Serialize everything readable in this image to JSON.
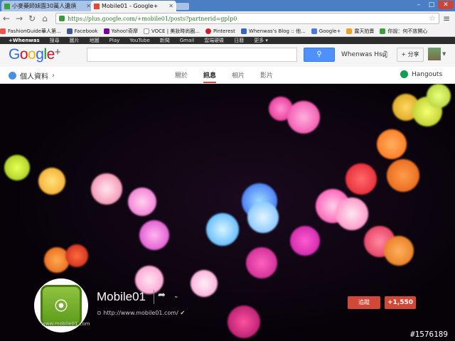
{
  "browser": {
    "tabs": [
      {
        "label": "小麥藥師妹園30萬人遺煩",
        "active": false
      },
      {
        "label": "Mobile01 - Google+",
        "active": true
      }
    ],
    "url": "https://plus.google.com/+mobile01/posts?partnerid=gplp0",
    "bookmarks": [
      "FashionGuide華人第...",
      "Facebook",
      "Yahoo!奇摩",
      "VOCE | 美妝時尚圈...",
      "Pinterest",
      "Whenwas's Blog :: 他...",
      "Google+",
      "露天拍賣",
      "你說：何不放開心"
    ]
  },
  "gbar": {
    "items": [
      "+Whenwas",
      "搜尋",
      "圖片",
      "地圖",
      "Play",
      "YouTube",
      "新聞",
      "Gmail",
      "雲端硬碟",
      "日曆",
      "更多 ▾"
    ]
  },
  "header": {
    "logo": "Google",
    "logo_plus": "+",
    "user_name": "Whenwas Hsu",
    "share_label": "+ 分享"
  },
  "subnav": {
    "profile_label": "個人資料",
    "tabs": [
      "關於",
      "訊息",
      "相片",
      "影片"
    ],
    "active_tab": "訊息",
    "hangouts_label": "Hangouts"
  },
  "page": {
    "name": "Mobile01",
    "url": "http://www.mobile01.com/",
    "avatar_caption": "www.mobile01.com",
    "follow_label": "追蹤",
    "plus_count": "+1,550"
  },
  "watermark": "#1576189",
  "colors": {
    "google_blue": "#3369e8",
    "google_red": "#d50f25",
    "google_yellow": "#eeb211",
    "google_green": "#009925",
    "follow_red": "#d14836",
    "search_blue": "#4d90fe"
  }
}
